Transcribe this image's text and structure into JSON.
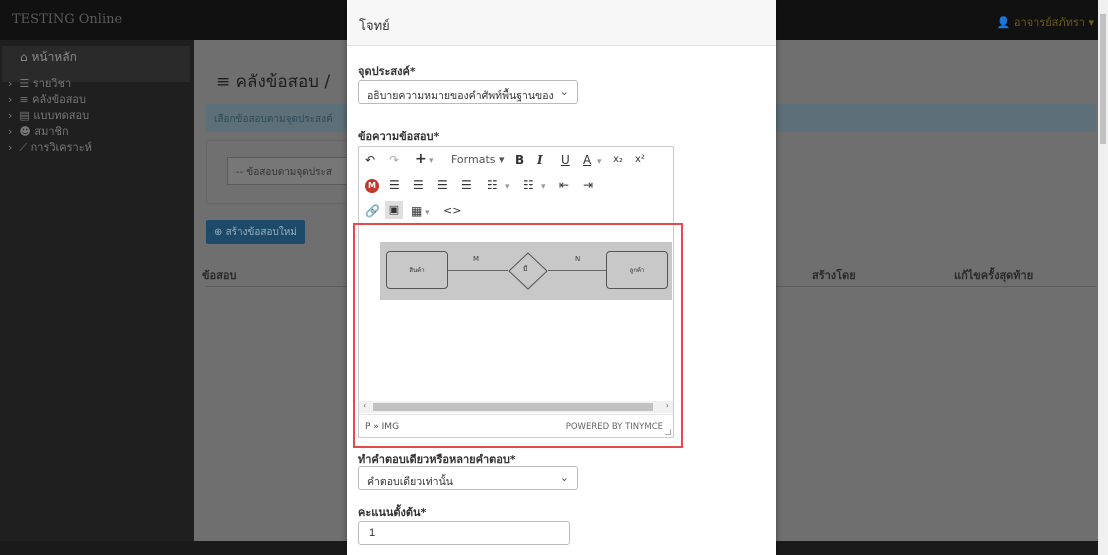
{
  "app": {
    "brand": "TESTING Online",
    "user": "อาจารย์สภัทรา"
  },
  "sidebar": {
    "home": "หน้าหลัก",
    "items": [
      {
        "label": "รายวิชา",
        "icon": "list-icon"
      },
      {
        "label": "คลังข้อสอบ",
        "icon": "database-icon"
      },
      {
        "label": "แบบทดสอบ",
        "icon": "book-icon"
      },
      {
        "label": "สมาชิก",
        "icon": "users-icon"
      },
      {
        "label": "การวิเคราะห์",
        "icon": "chart-icon"
      }
    ]
  },
  "page": {
    "title": "คลังข้อสอบ /",
    "info": "เลือกข้อสอบตามจุดประสงค์",
    "filter_placeholder": "-- ข้อสอบตามจุดประส",
    "new_button": "สร้างข้อสอบใหม่",
    "table_headers": [
      "ข้อสอบ",
      "สร้างโดย",
      "แก้ไขครั้งสุดท้าย"
    ]
  },
  "modal": {
    "title": "โจทย์",
    "objective_label": "จุดประสงค์",
    "objective_value": "อธิบายความหมายของคำศัพท์พื้นฐานของ",
    "question_label": "ข้อความข้อสอบ",
    "editor": {
      "formats_label": "Formats",
      "image": {
        "left_entity": "สินค้า",
        "relationship": "มี",
        "right_entity": "ลูกค้า",
        "left_card": "M",
        "right_card": "N"
      },
      "path": "P » IMG",
      "powered_by": "POWERED BY TINYMCE"
    },
    "answer_type_label": "ทำคำตอบเดียวหรือหลายคำตอบ",
    "answer_type_value": "คำตอบเดียวเท่านั้น",
    "score_label": "คะแนนตั้งต้น",
    "score_value": "1",
    "required_mark": "*"
  },
  "colors": {
    "highlight": "#e24b4b",
    "primary_button": "#337ab7"
  }
}
